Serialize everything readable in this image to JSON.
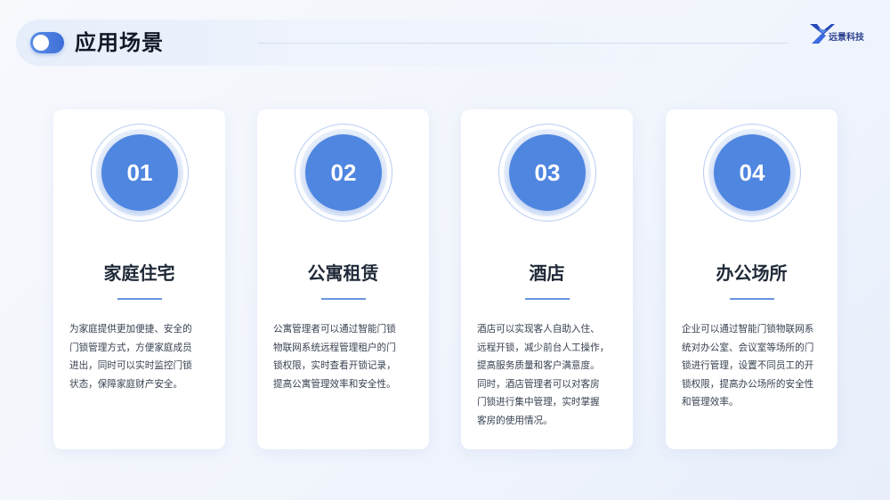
{
  "header": {
    "title": "应用场景",
    "logo_text": "远景科技"
  },
  "colors": {
    "accent": "#4f86e0",
    "title": "#111827",
    "underline": "#6a95de"
  },
  "cards": [
    {
      "number": "01",
      "title": "家庭住宅",
      "lines": [
        "为家庭提供更加便捷、安全的",
        "门锁管理方式，方便家庭成员",
        "进出，同时可以实时监控门锁",
        "状态，保障家庭财产安全。"
      ]
    },
    {
      "number": "02",
      "title": "公寓租赁",
      "lines": [
        "公寓管理者可以通过智能门锁",
        "物联网系统远程管理租户的门",
        "锁权限，实时查看开锁记录，",
        "提高公寓管理效率和安全性。"
      ]
    },
    {
      "number": "03",
      "title": "酒店",
      "lines": [
        "酒店可以实现客人自助入住、",
        "远程开锁，减少前台人工操作，",
        "提高服务质量和客户满意度。",
        "同时，酒店管理者可以对客房",
        "门锁进行集中管理，实时掌握",
        "客房的使用情况。"
      ]
    },
    {
      "number": "04",
      "title": "办公场所",
      "lines": [
        "企业可以通过智能门锁物联网系",
        "统对办公室、会议室等场所的门",
        "锁进行管理，设置不同员工的开",
        "锁权限，提高办公场所的安全性",
        "和管理效率。"
      ]
    }
  ]
}
